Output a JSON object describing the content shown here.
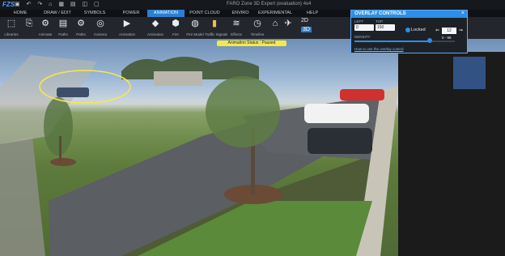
{
  "app": {
    "logo": "FZS",
    "title": "FARO Zone 3D Expert (evaluation) 4x4",
    "quick_access": "▣ ↶ ↷ ⌂ ▦ ▤ ◫ ▢"
  },
  "tabs": [
    {
      "label": "Home"
    },
    {
      "label": "Draw / Edit"
    },
    {
      "label": "Symbols"
    },
    {
      "label": "Power Tools"
    },
    {
      "label": "Animation"
    },
    {
      "label": "Point Cloud"
    },
    {
      "label": "Enviro"
    },
    {
      "label": "Experimental"
    },
    {
      "label": "Help"
    }
  ],
  "active_tab": "Animation",
  "ribbon": [
    {
      "icon": "⬚",
      "label": "Libraries"
    },
    {
      "icon": "⎘",
      "label": ""
    },
    {
      "icon": "⚙",
      "label": "Animate"
    },
    {
      "icon": "▤",
      "label": "Paths"
    },
    {
      "icon": "⚙",
      "label": "Paths"
    },
    {
      "icon": "◎",
      "label": "Camera"
    },
    {
      "icon": "▶",
      "label": "Animation"
    },
    {
      "icon": "◆",
      "label": "Animation"
    },
    {
      "icon": "⬢",
      "label": "Fire"
    },
    {
      "icon": "◍",
      "label": "Fire Model"
    },
    {
      "icon": "▮",
      "label": "Traffic Signals"
    },
    {
      "icon": "≋",
      "label": "Effects"
    },
    {
      "icon": "◷",
      "label": "Timeline"
    },
    {
      "icon": "⌂",
      "label": ""
    },
    {
      "icon": "✈",
      "label": ""
    }
  ],
  "status_text": "Animation Status : Paused",
  "overlay": {
    "title": "OVERLAY CONTROLS",
    "left_label": "LEFT",
    "left_value": "0",
    "top_label": "TOP",
    "top_value": "150",
    "locked_label": "Locked",
    "stepper_value": "12",
    "range_text": "0 - 99",
    "density_label": "DENSITY",
    "density_value": 0.75,
    "help_link": "How to use the overlay control"
  },
  "view_toggles": [
    "2D",
    "3D"
  ]
}
